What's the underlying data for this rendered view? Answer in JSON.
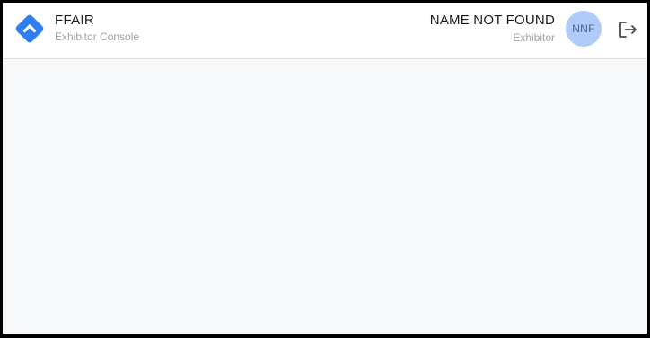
{
  "brand": {
    "name": "FFAIR",
    "subtitle": "Exhibitor Console",
    "logo_icon": "diamond-logo-icon",
    "logo_color": "#2f7ff2"
  },
  "user": {
    "name": "NAME NOT FOUND",
    "role": "Exhibitor",
    "initials": "NNF",
    "avatar_color": "#aecbfa"
  },
  "actions": {
    "logout_icon": "logout-icon"
  },
  "main": {}
}
